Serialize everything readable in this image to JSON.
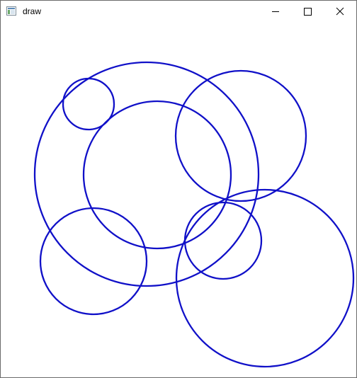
{
  "window": {
    "title": "draw",
    "controls": {
      "minimize": "minimize-icon",
      "maximize": "maximize-icon",
      "close": "close-icon"
    }
  },
  "canvas": {
    "shapes": "circles",
    "stroke_color": "#1010c8",
    "count": 7
  }
}
